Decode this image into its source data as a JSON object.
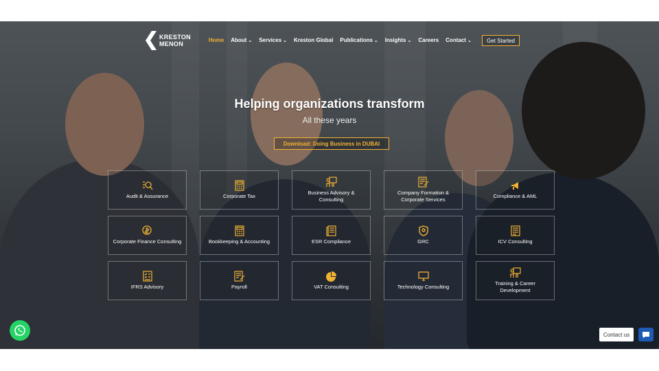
{
  "brand": {
    "line1": "KRESTON",
    "line2": "MENON"
  },
  "nav": {
    "items": [
      {
        "label": "Home",
        "dropdown": false,
        "active": true
      },
      {
        "label": "About",
        "dropdown": true
      },
      {
        "label": "Services",
        "dropdown": true
      },
      {
        "label": "Kreston Global",
        "dropdown": false
      },
      {
        "label": "Publications",
        "dropdown": true
      },
      {
        "label": "Insights",
        "dropdown": true
      },
      {
        "label": "Careers",
        "dropdown": false
      },
      {
        "label": "Contact",
        "dropdown": true
      }
    ],
    "cta": "Get Started"
  },
  "hero": {
    "title": "Helping organizations transform",
    "subtitle": "All these years",
    "download": "Download: Doing Business in DUBAI"
  },
  "services": [
    {
      "label": "Audit & Assurance",
      "icon": "audit-icon"
    },
    {
      "label": "Corporate Tax",
      "icon": "calculator-icon"
    },
    {
      "label": "Business Advisory & Consulting",
      "icon": "presentation-icon"
    },
    {
      "label": "Company Formation & Corporate Services",
      "icon": "document-edit-icon"
    },
    {
      "label": "Compliance & AML",
      "icon": "megaphone-icon"
    },
    {
      "label": "Corporate Finance Consulting",
      "icon": "finance-icon"
    },
    {
      "label": "Bookkeeping & Accounting",
      "icon": "calculator-icon"
    },
    {
      "label": "ESR Compliance",
      "icon": "report-icon"
    },
    {
      "label": "GRC",
      "icon": "shield-icon"
    },
    {
      "label": "ICV Consulting",
      "icon": "document-icon"
    },
    {
      "label": "IFRS Advisory",
      "icon": "checklist-icon"
    },
    {
      "label": "Payroll",
      "icon": "document-edit-icon"
    },
    {
      "label": "VAT Consulting",
      "icon": "pie-chart-icon"
    },
    {
      "label": "Technology Consulting",
      "icon": "monitor-icon"
    },
    {
      "label": "Training & Career Development",
      "icon": "presentation-icon"
    }
  ],
  "widgets": {
    "contact_label": "Contact us"
  },
  "colors": {
    "accent": "#f2b233",
    "whatsapp": "#25d366",
    "chat": "#1e5bb5"
  }
}
